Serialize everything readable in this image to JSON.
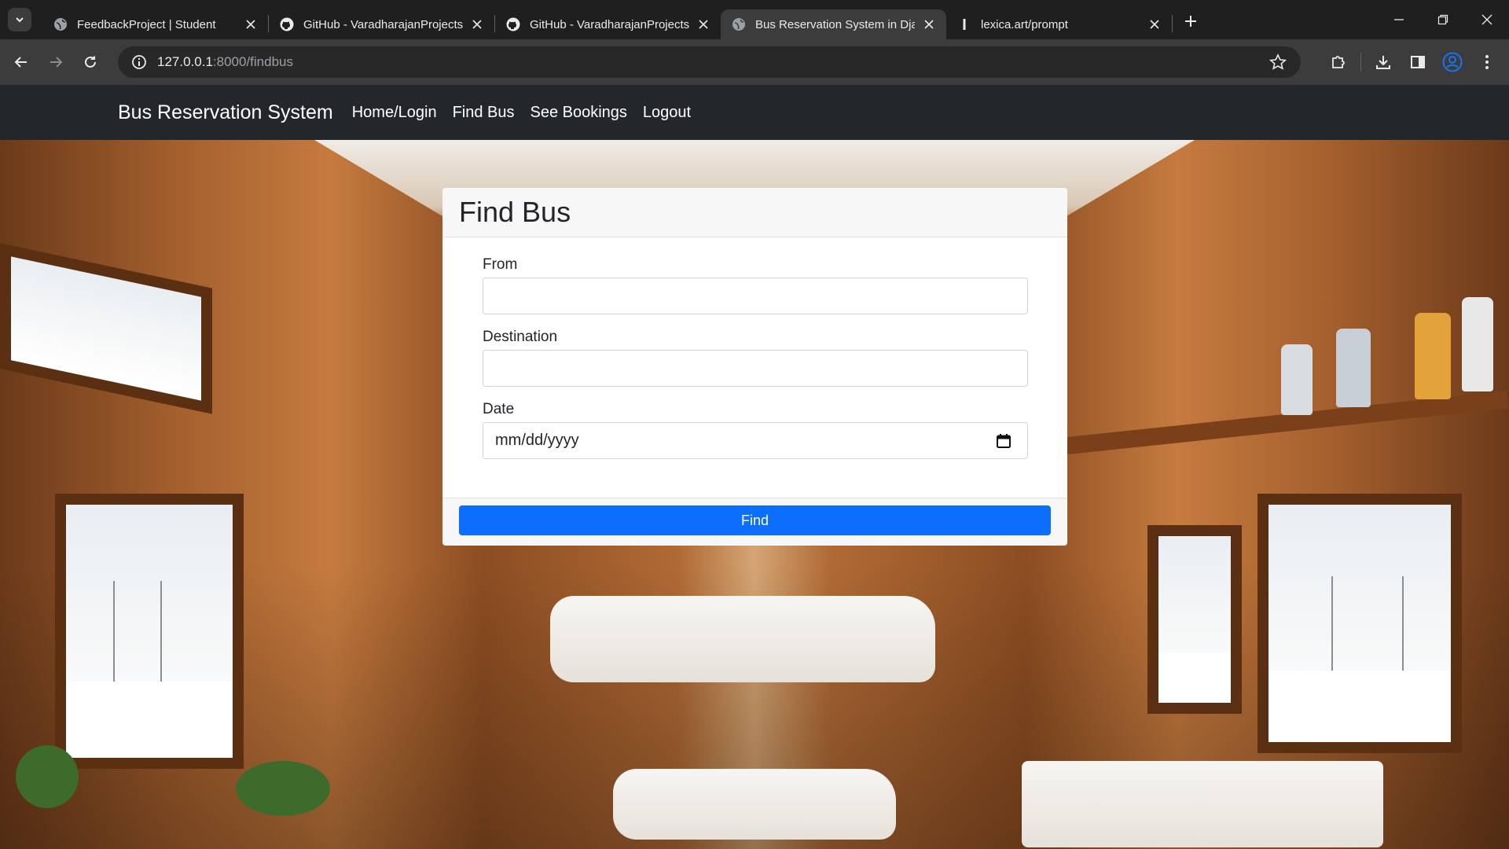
{
  "browser": {
    "tabs": [
      {
        "title": "FeedbackProject | Student",
        "icon": "globe-icon",
        "active": false
      },
      {
        "title": "GitHub - VaradharajanProjects/",
        "icon": "github-icon",
        "active": false
      },
      {
        "title": "GitHub - VaradharajanProjects/",
        "icon": "github-icon",
        "active": false
      },
      {
        "title": "Bus Reservation System in Djan",
        "icon": "globe-icon",
        "active": true
      },
      {
        "title": "lexica.art/prompt",
        "icon": "lexica-icon",
        "active": false
      }
    ],
    "url_host": "127.0.0.1",
    "url_path": ":8000/findbus"
  },
  "navbar": {
    "brand": "Bus Reservation System",
    "links": [
      "Home/Login",
      "Find Bus",
      "See Bookings",
      "Logout"
    ]
  },
  "form": {
    "title": "Find Bus",
    "from_label": "From",
    "from_value": "",
    "destination_label": "Destination",
    "destination_value": "",
    "date_label": "Date",
    "date_placeholder": "mm/dd/yyyy",
    "submit_label": "Find"
  },
  "colors": {
    "navbar_bg": "#23272b",
    "primary": "#0d6efd",
    "chrome_dark": "#1f1f1f"
  }
}
